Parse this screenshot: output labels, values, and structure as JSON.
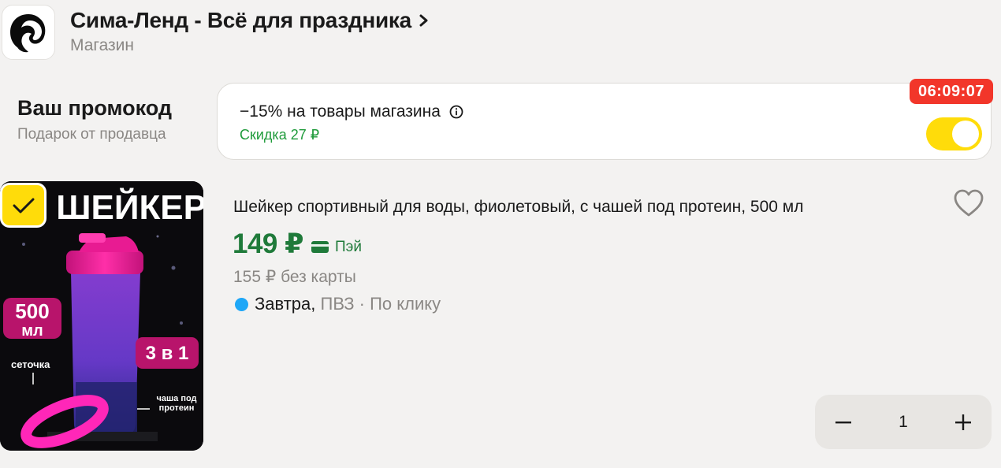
{
  "store": {
    "name": "Сима-Ленд - Всё для праздника",
    "type": "Магазин",
    "logo_icon": "dolphin-logo-icon"
  },
  "promo": {
    "title": "Ваш промокод",
    "subtitle": "Подарок от продавца",
    "offer": "−15% на товары магазина",
    "discount": "Скидка 27 ₽",
    "timer": "06:09:07",
    "enabled": true,
    "colors": {
      "toggle": "#ffdc0a",
      "timer": "#f2362a",
      "discount": "#1f9b3b"
    }
  },
  "product": {
    "selected": true,
    "title": "Шейкер спортивный для воды, фиолетовый, с чашей под протеин, 500 мл",
    "price": "149 ₽",
    "pay_label": "Пэй",
    "old_price": "155 ₽ без карты",
    "delivery_day": "Завтра,",
    "delivery_rest": "ПВЗ · По клику",
    "image_texts": {
      "heading": "ШЕЙКЕР",
      "volume_number": "500",
      "volume_unit": "мл",
      "three_in_one": "3 в 1",
      "mesh": "сеточка",
      "cup": "чаша под протеин"
    },
    "favorite": false,
    "quantity": "1",
    "colors": {
      "price": "#1f7a3a",
      "delivery_dot": "#1ea7f7"
    }
  }
}
